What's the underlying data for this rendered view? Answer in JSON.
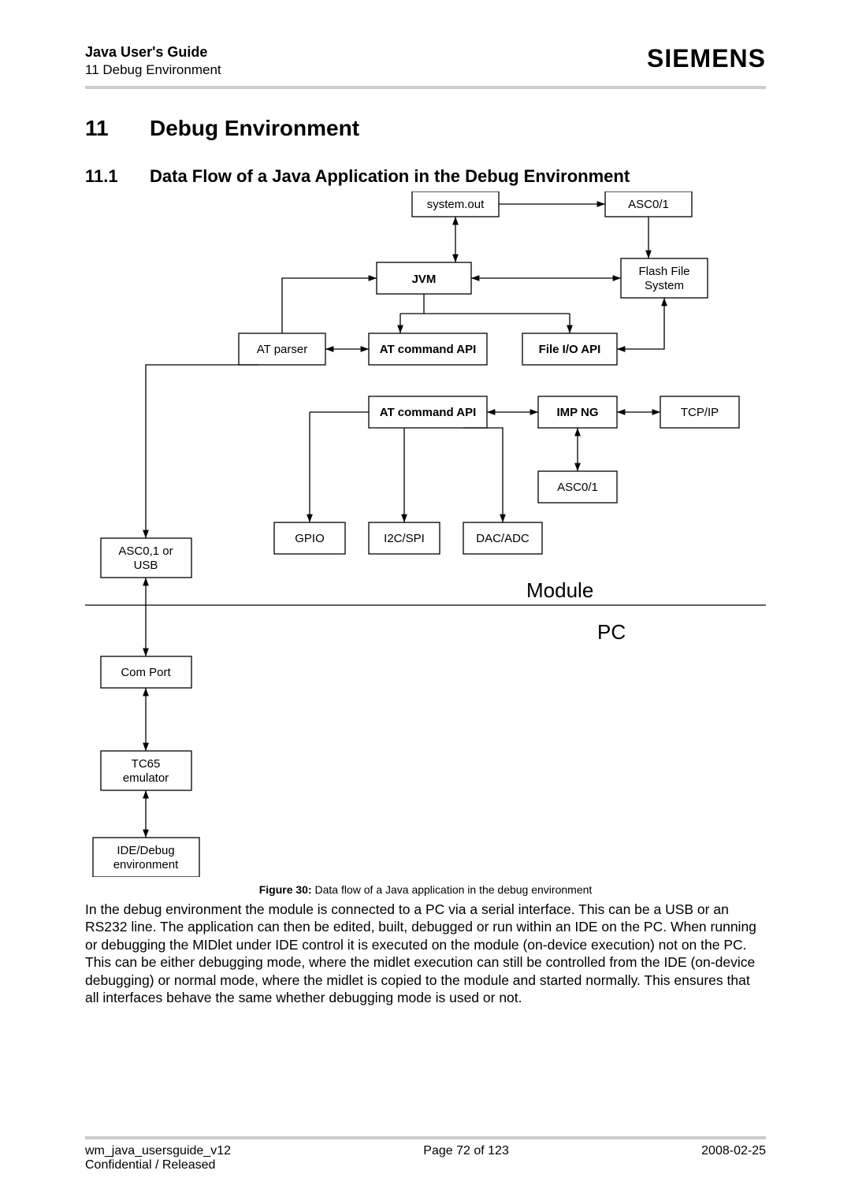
{
  "header": {
    "title": "Java User's Guide",
    "subtitle": "11 Debug Environment",
    "brand": "SIEMENS"
  },
  "section": {
    "num": "11",
    "title": "Debug Environment"
  },
  "subsection": {
    "num": "11.1",
    "title": "Data Flow of a Java Application in the Debug Environment"
  },
  "chart_data": {
    "type": "diagram",
    "regions": [
      "Module",
      "PC"
    ],
    "nodes": [
      {
        "id": "systemout",
        "label": "system.out",
        "region": "Module"
      },
      {
        "id": "asc01top",
        "label": "ASC0/1",
        "region": "Module"
      },
      {
        "id": "jvm",
        "label": "JVM",
        "region": "Module",
        "bold": true
      },
      {
        "id": "ffs",
        "label": "Flash File System",
        "region": "Module"
      },
      {
        "id": "atparser",
        "label": "AT parser",
        "region": "Module"
      },
      {
        "id": "atcmd1",
        "label": "AT command API",
        "region": "Module",
        "bold": true
      },
      {
        "id": "fileio",
        "label": "File I/O API",
        "region": "Module",
        "bold": true
      },
      {
        "id": "atcmd2",
        "label": "AT command API",
        "region": "Module",
        "bold": true
      },
      {
        "id": "impng",
        "label": "IMP NG",
        "region": "Module",
        "bold": true
      },
      {
        "id": "tcpip",
        "label": "TCP/IP",
        "region": "Module"
      },
      {
        "id": "asc01mid",
        "label": "ASC0/1",
        "region": "Module"
      },
      {
        "id": "gpio",
        "label": "GPIO",
        "region": "Module"
      },
      {
        "id": "i2cspi",
        "label": "I2C/SPI",
        "region": "Module"
      },
      {
        "id": "dacadc",
        "label": "DAC/ADC",
        "region": "Module"
      },
      {
        "id": "asc01usb",
        "label": "ASC0,1 or USB",
        "region": "Module"
      },
      {
        "id": "comport",
        "label": "Com Port",
        "region": "PC"
      },
      {
        "id": "tc65",
        "label": "TC65 emulator",
        "region": "PC"
      },
      {
        "id": "ide",
        "label": "IDE/Debug environment",
        "region": "PC"
      }
    ],
    "edges": [
      [
        "systemout",
        "asc01top",
        "uni"
      ],
      [
        "jvm",
        "systemout",
        "bi"
      ],
      [
        "asc01top",
        "ffs",
        "uni"
      ],
      [
        "jvm",
        "ffs",
        "bi"
      ],
      [
        "jvm",
        "atcmd1",
        "uni"
      ],
      [
        "jvm",
        "fileio",
        "uni"
      ],
      [
        "atparser",
        "atcmd1",
        "bi"
      ],
      [
        "fileio",
        "ffs",
        "uni"
      ],
      [
        "atcmd2",
        "impng",
        "bi"
      ],
      [
        "impng",
        "tcpip",
        "bi"
      ],
      [
        "impng",
        "asc01mid",
        "bi"
      ],
      [
        "atparser",
        "asc01usb",
        "uni"
      ],
      [
        "atcmd2",
        "gpio",
        "uni"
      ],
      [
        "atcmd2",
        "i2cspi",
        "uni"
      ],
      [
        "atcmd2",
        "dacadc",
        "uni"
      ],
      [
        "asc01usb",
        "comport",
        "bi"
      ],
      [
        "comport",
        "tc65",
        "bi"
      ],
      [
        "tc65",
        "ide",
        "bi"
      ]
    ]
  },
  "diagram_labels": {
    "systemout": "system.out",
    "asc01top": "ASC0/1",
    "jvm": "JVM",
    "ffs_l1": "Flash File",
    "ffs_l2": "System",
    "atparser": "AT parser",
    "atcmd1": "AT command API",
    "fileio": "File I/O API",
    "atcmd2": "AT command API",
    "impng": "IMP NG",
    "tcpip": "TCP/IP",
    "asc01mid": "ASC0/1",
    "gpio": "GPIO",
    "i2cspi": "I2C/SPI",
    "dacadc": "DAC/ADC",
    "asc01usb_l1": "ASC0,1 or",
    "asc01usb_l2": "USB",
    "module": "Module",
    "pc": "PC",
    "comport": "Com Port",
    "tc65_l1": "TC65",
    "tc65_l2": "emulator",
    "ide_l1": "IDE/Debug",
    "ide_l2": "environment"
  },
  "figure": {
    "label": "Figure 30:",
    "caption": "Data flow of a Java application in the debug environment"
  },
  "body": "In the debug environment the module is connected to a PC via a serial interface. This can be a USB or an RS232 line. The application can then be edited, built, debugged or run within an IDE on the PC. When running or debugging the MIDlet under IDE control it is executed on the module (on-device execution) not on the PC. This can be either debugging mode, where the midlet execution can still be controlled from the IDE (on-device debugging) or normal mode, where the midlet is copied to the module and started normally. This ensures that all interfaces behave the same whether debugging mode is used or not.",
  "footer": {
    "doc": "wm_java_usersguide_v12",
    "class": "Confidential / Released",
    "page": "Page 72 of 123",
    "date": "2008-02-25"
  }
}
